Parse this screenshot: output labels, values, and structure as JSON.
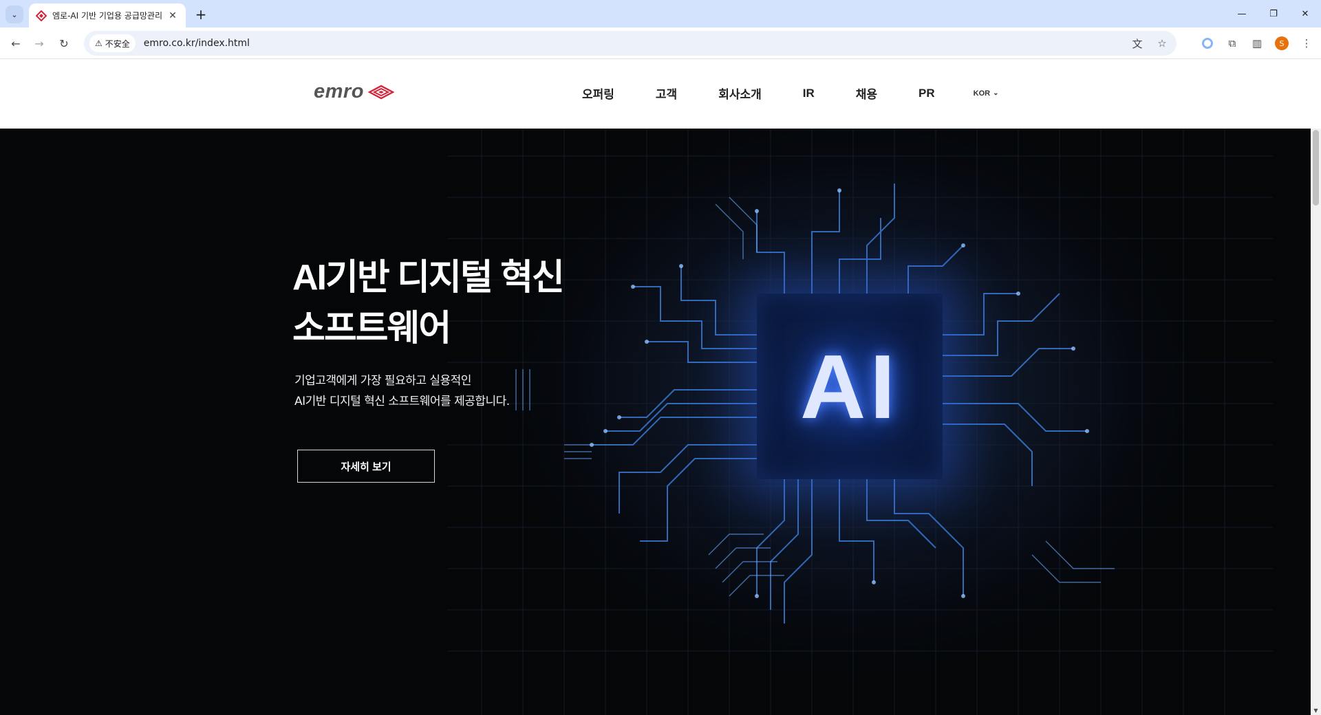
{
  "browser": {
    "tab_title": "엠로-AI 기반 기업용 공급망관리",
    "url": "emro.co.kr/index.html",
    "security_label": "不安全",
    "profile_initial": "S"
  },
  "header": {
    "logo_text": "emro",
    "nav": [
      "오퍼링",
      "고객",
      "회사소개",
      "IR",
      "채용",
      "PR"
    ],
    "language": "KOR"
  },
  "hero": {
    "title_line1": "AI기반 디지털 혁신",
    "title_line2": "소프트웨어",
    "sub_line1": "기업고객에게 가장 필요하고 실용적인",
    "sub_line2": "AI기반 디지털 혁신 소프트웨어를 제공합니다.",
    "button_label": "자세히 보기",
    "chip_label": "AI"
  },
  "colors": {
    "brand_red": "#d3253a",
    "chrome_blue": "#d3e3fd",
    "hero_dark": "#06090f",
    "circuit_blue": "#3a7bd5"
  }
}
